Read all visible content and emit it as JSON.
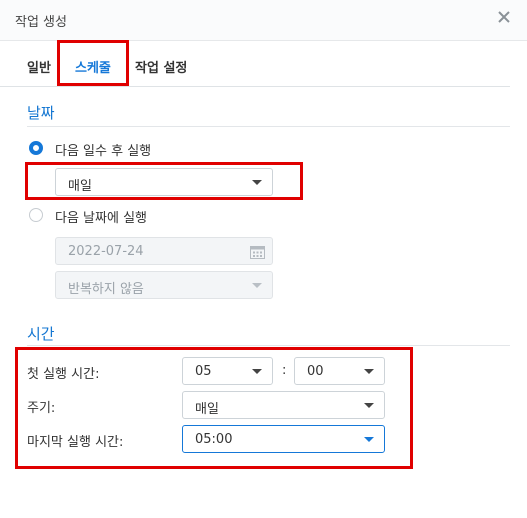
{
  "dialog": {
    "title": "작업 생성",
    "close_icon": "close-icon"
  },
  "tabs": [
    {
      "label": "일반",
      "active": false
    },
    {
      "label": "스케줄",
      "active": true
    },
    {
      "label": "작업 설정",
      "active": false
    }
  ],
  "date_section": {
    "title": "날짜",
    "option_repeat": {
      "label": "다음 일수 후 실행",
      "checked": true,
      "select_value": "매일"
    },
    "option_date": {
      "label": "다음 날짜에 실행",
      "checked": false,
      "date_value": "2022-07-24",
      "repeat_value": "반복하지 않음"
    }
  },
  "time_section": {
    "title": "시간",
    "first_run_label": "첫 실행 시간:",
    "hour_value": "05",
    "colon": ":",
    "minute_value": "00",
    "frequency_label": "주기:",
    "frequency_value": "매일",
    "last_run_label": "마지막 실행 시간:",
    "last_run_value": "05:00"
  },
  "colors": {
    "accent": "#1578d8",
    "annotation": "#e00000"
  }
}
